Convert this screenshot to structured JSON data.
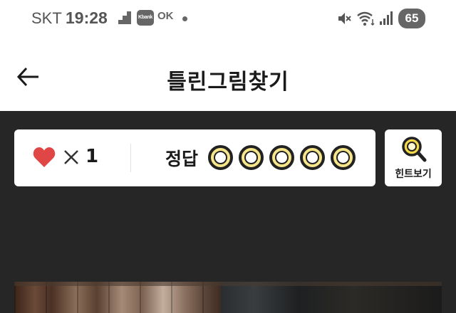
{
  "status_bar": {
    "carrier": "SKT",
    "time": "19:28",
    "kbank_label": "Kbank",
    "ok_label": "OK",
    "battery": "65"
  },
  "header": {
    "title": "틀린그림찾기"
  },
  "score": {
    "lives_count": "1",
    "answer_label": "정답",
    "answers_found": 0,
    "answers_total": 5
  },
  "hint": {
    "label": "힌트보기"
  },
  "colors": {
    "game_background": "#262626",
    "heart": "#e04646",
    "circle_fill": "#f7e58a",
    "hint_lens": "#f5d94a"
  },
  "icons": [
    "stairs-icon",
    "kbank-icon",
    "ok-icon",
    "mute-icon",
    "wifi-icon",
    "signal-icon",
    "back-arrow-icon",
    "heart-icon",
    "times-icon",
    "magnifier-icon"
  ]
}
